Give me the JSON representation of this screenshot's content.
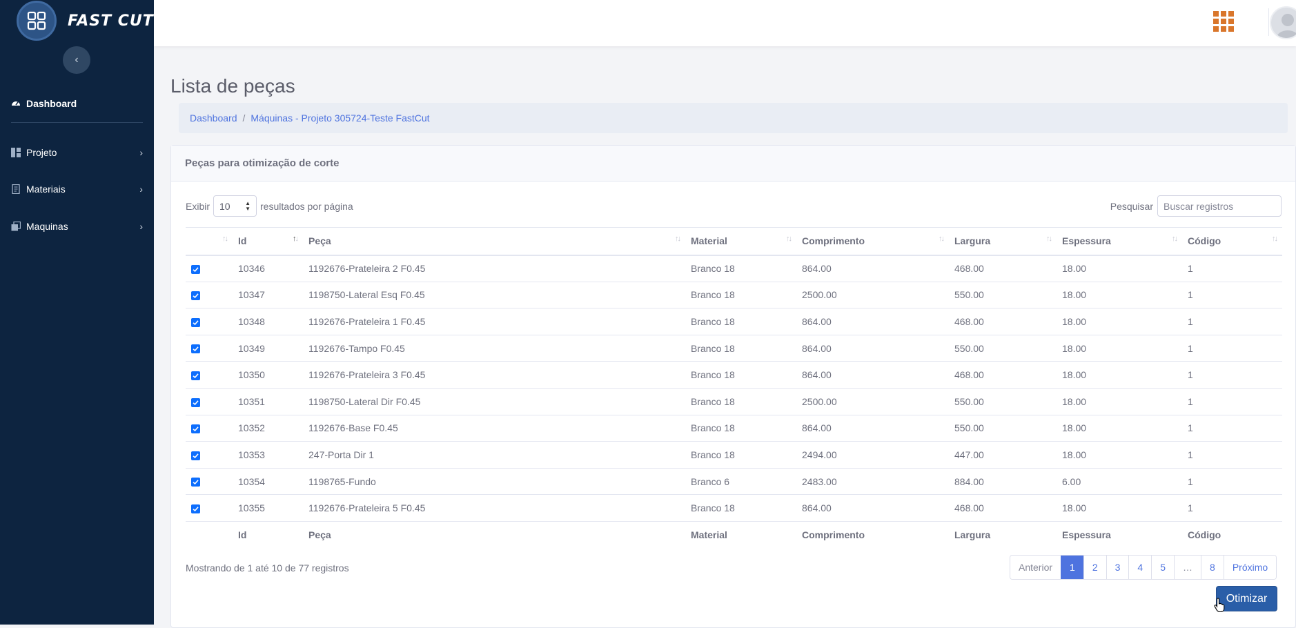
{
  "brand": {
    "name": "FAST CUT"
  },
  "sidebar": {
    "items": [
      {
        "label": "Dashboard",
        "icon": "tachometer-icon"
      },
      {
        "label": "Projeto",
        "icon": "columns-icon"
      },
      {
        "label": "Materiais",
        "icon": "document-icon"
      },
      {
        "label": "Maquinas",
        "icon": "clone-icon"
      }
    ]
  },
  "page": {
    "title": "Lista de peças"
  },
  "breadcrumb": {
    "home": "Dashboard",
    "current": "Máquinas - Projeto 305724-Teste FastCut"
  },
  "card": {
    "title": "Peças para otimização de corte"
  },
  "length": {
    "prefix": "Exibir",
    "value": "10",
    "suffix": "resultados por página"
  },
  "search": {
    "label": "Pesquisar",
    "placeholder": "Buscar registros"
  },
  "table": {
    "headers": [
      "Id",
      "Peça",
      "Material",
      "Comprimento",
      "Largura",
      "Espessura",
      "Código"
    ],
    "rows": [
      {
        "checked": true,
        "cells": [
          "10346",
          "1192676-Prateleira 2 F0.45",
          "Branco 18",
          "864.00",
          "468.00",
          "18.00",
          "1"
        ]
      },
      {
        "checked": true,
        "cells": [
          "10347",
          "1198750-Lateral Esq F0.45",
          "Branco 18",
          "2500.00",
          "550.00",
          "18.00",
          "1"
        ]
      },
      {
        "checked": true,
        "cells": [
          "10348",
          "1192676-Prateleira 1 F0.45",
          "Branco 18",
          "864.00",
          "468.00",
          "18.00",
          "1"
        ]
      },
      {
        "checked": true,
        "cells": [
          "10349",
          "1192676-Tampo F0.45",
          "Branco 18",
          "864.00",
          "550.00",
          "18.00",
          "1"
        ]
      },
      {
        "checked": true,
        "cells": [
          "10350",
          "1192676-Prateleira 3 F0.45",
          "Branco 18",
          "864.00",
          "468.00",
          "18.00",
          "1"
        ]
      },
      {
        "checked": true,
        "cells": [
          "10351",
          "1198750-Lateral Dir F0.45",
          "Branco 18",
          "2500.00",
          "550.00",
          "18.00",
          "1"
        ]
      },
      {
        "checked": true,
        "cells": [
          "10352",
          "1192676-Base F0.45",
          "Branco 18",
          "864.00",
          "550.00",
          "18.00",
          "1"
        ]
      },
      {
        "checked": true,
        "cells": [
          "10353",
          "247-Porta Dir 1",
          "Branco 18",
          "2494.00",
          "447.00",
          "18.00",
          "1"
        ]
      },
      {
        "checked": true,
        "cells": [
          "10354",
          "1198765-Fundo",
          "Branco 6",
          "2483.00",
          "884.00",
          "6.00",
          "1"
        ]
      },
      {
        "checked": true,
        "cells": [
          "10355",
          "1192676-Prateleira 5 F0.45",
          "Branco 18",
          "864.00",
          "468.00",
          "18.00",
          "1"
        ]
      }
    ]
  },
  "info": "Mostrando de 1 até 10 de 77 registros",
  "pagination": {
    "prev": "Anterior",
    "pages": [
      "1",
      "2",
      "3",
      "4",
      "5",
      "…",
      "8"
    ],
    "active": "1",
    "next": "Próximo"
  },
  "actions": {
    "optimize": "Otimizar"
  },
  "colors": {
    "sidebar": "#0d2440",
    "primary": "#4e73df",
    "button": "#2a5ea8",
    "apps_icon": "#d9762b"
  }
}
